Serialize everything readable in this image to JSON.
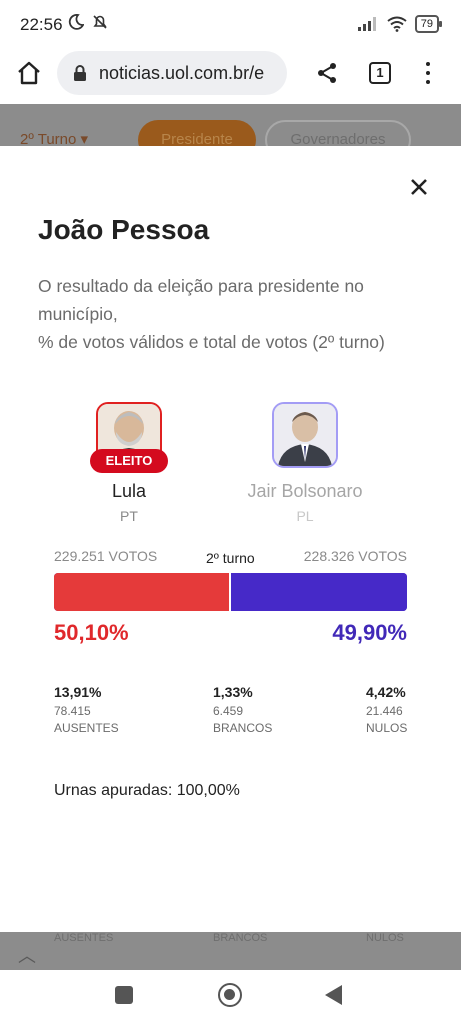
{
  "status_bar": {
    "time": "22:56",
    "battery": "79",
    "icons_left": [
      "moon-icon",
      "bell-off-icon"
    ],
    "icons_right": [
      "signal-icon",
      "wifi-icon",
      "battery-icon"
    ]
  },
  "browser": {
    "url": "noticias.uol.com.br/e",
    "tab_count": "1"
  },
  "background_page": {
    "turno_select": "2º Turno ▾",
    "tab_presidente": "Presidente",
    "tab_governadores": "Governadores",
    "bottom_labels": [
      "AUSENTES",
      "BRANCOS",
      "NULOS"
    ]
  },
  "modal": {
    "title": "João Pessoa",
    "description": "O resultado da eleição para presidente no município,\n% de votos válidos e total de votos (2º turno)",
    "candidates": [
      {
        "name": "Lula",
        "party": "PT",
        "badge": "ELEITO",
        "accent": "#e02020"
      },
      {
        "name": "Jair Bolsonaro",
        "party": "PL",
        "accent": "#4629c8"
      }
    ],
    "votes_left": "229.251 VOTOS",
    "votes_right": "228.326 VOTOS",
    "turno_label": "2º turno",
    "pct_left": "50,10%",
    "pct_right": "49,90%",
    "bar_left_fraction": 0.501,
    "stats": [
      {
        "pct": "13,91%",
        "count": "78.415",
        "label": "AUSENTES"
      },
      {
        "pct": "1,33%",
        "count": "6.459",
        "label": "BRANCOS"
      },
      {
        "pct": "4,42%",
        "count": "21.446",
        "label": "NULOS"
      }
    ],
    "urnas": "Urnas apuradas: 100,00%"
  }
}
